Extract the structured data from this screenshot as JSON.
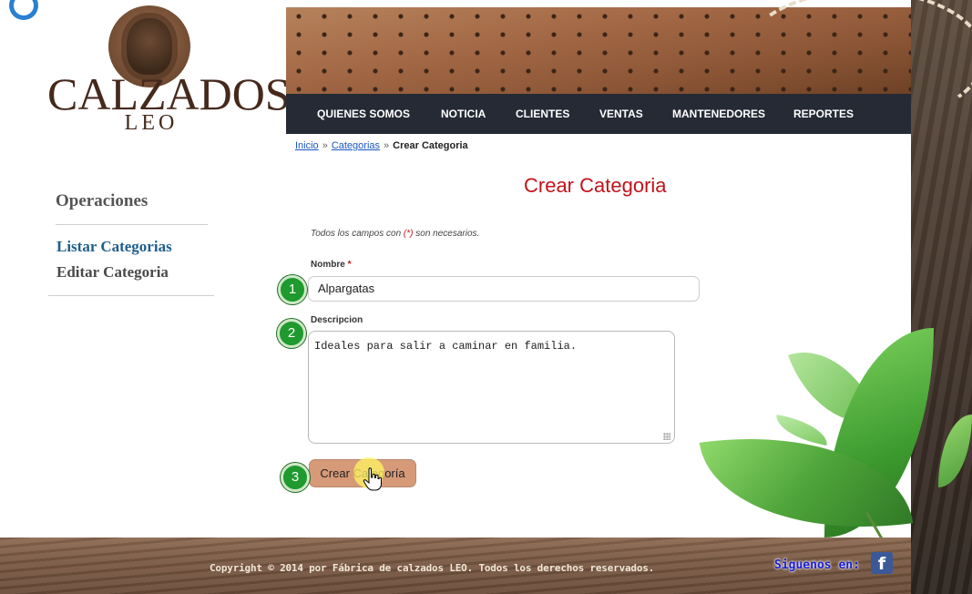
{
  "brand": {
    "name": "CALZADOS",
    "sub": "LEO"
  },
  "nav": {
    "items": [
      {
        "label": "QUIENES SOMOS"
      },
      {
        "label": "NOTICIA"
      },
      {
        "label": "CLIENTES"
      },
      {
        "label": "VENTAS"
      },
      {
        "label": "MANTENEDORES"
      },
      {
        "label": "REPORTES"
      }
    ]
  },
  "breadcrumb": {
    "home": "Inicio",
    "separator": "»",
    "category": "Categorias",
    "current": "Crear Categoria"
  },
  "sidebar": {
    "title": "Operaciones",
    "links": [
      {
        "label": "Listar Categorias"
      },
      {
        "label": "Editar Categoria"
      }
    ]
  },
  "form": {
    "title": "Crear Categoria",
    "note_before": "Todos los campos con ",
    "note_star": "(*)",
    "note_after": " son necesarios.",
    "name_label": "Nombre",
    "required_mark": "*",
    "name_value": "Alpargatas",
    "description_label": "Descripcion",
    "description_value": "Ideales para salir a caminar en familia.",
    "submit_label": "Crear Categoría"
  },
  "markers": [
    "1",
    "2",
    "3"
  ],
  "footer": {
    "copyright": "Copyright © 2014 por Fábrica de calzados LEO. Todos los derechos reservados.",
    "follow": "Siguenos en:",
    "facebook_icon": "f"
  },
  "colors": {
    "nav_bg": "#252a35",
    "title_red": "#c2141a",
    "link_blue": "#1f5e8c",
    "button_bg": "#d69a78",
    "marker_green": "#1f9a2e"
  }
}
